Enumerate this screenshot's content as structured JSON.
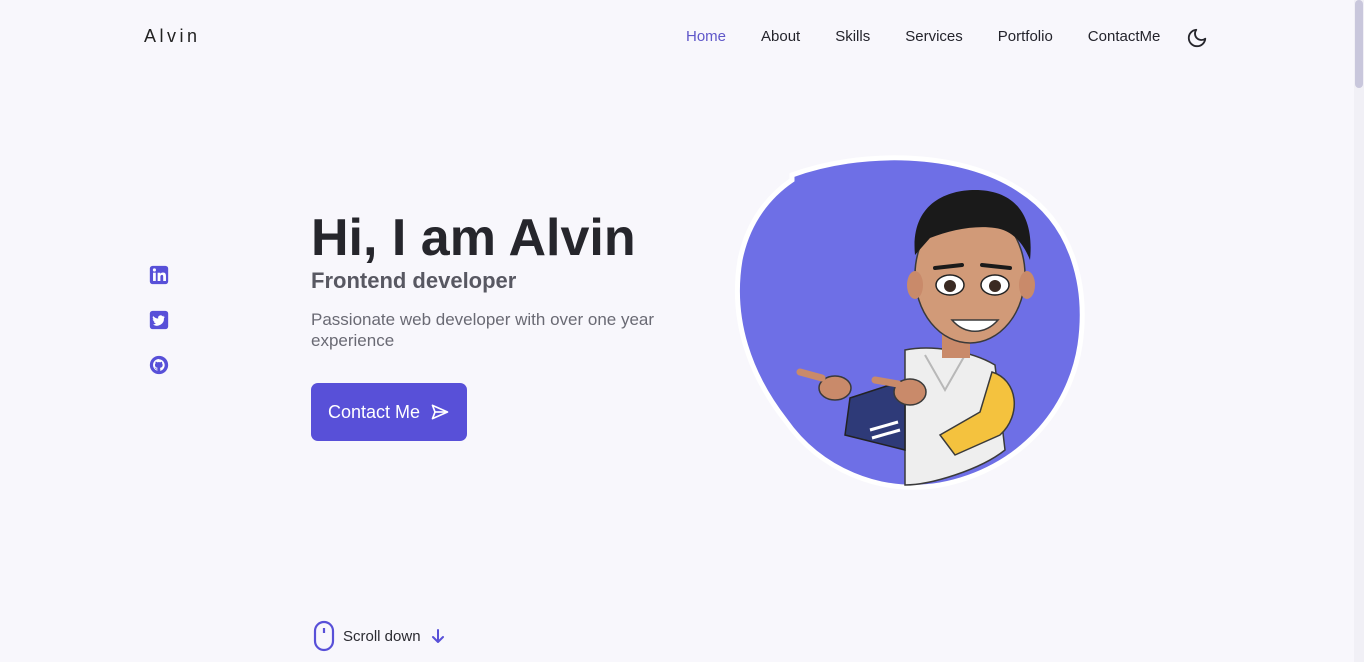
{
  "header": {
    "logo": "Alvin",
    "nav": [
      "Home",
      "About",
      "Skills",
      "Services",
      "Portfolio",
      "ContactMe"
    ],
    "active_nav": "Home",
    "theme_icon": "moon-icon"
  },
  "socials": [
    "linkedin-icon",
    "twitter-icon",
    "github-icon"
  ],
  "hero": {
    "title": "Hi, I am Alvin",
    "subtitle": "Frontend developer",
    "description": "Passionate web developer with over one year experience",
    "cta_label": "Contact Me",
    "cta_icon": "send-icon"
  },
  "scroll": {
    "label": "Scroll down",
    "mouse_icon": "mouse-icon",
    "arrow_icon": "arrow-down-icon"
  },
  "colors": {
    "accent": "#5850d8",
    "blob": "#6e6fe6",
    "background": "#f8f7fc"
  }
}
